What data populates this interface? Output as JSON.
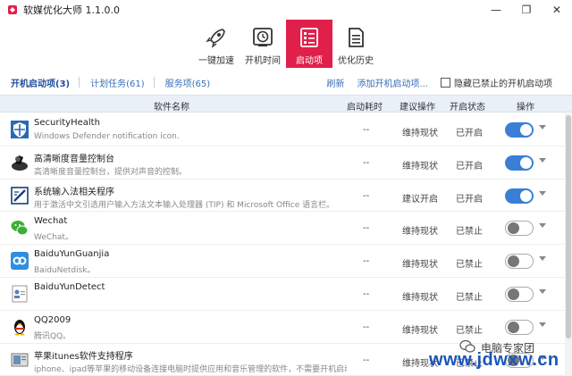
{
  "window": {
    "title": "软媒优化大师 1.1.0.0",
    "minimize": "—",
    "restore": "❐",
    "close": "✕"
  },
  "toolbar": [
    {
      "label": "一键加速",
      "icon": "rocket-icon",
      "active": false
    },
    {
      "label": "开机时间",
      "icon": "clock-icon",
      "active": false
    },
    {
      "label": "启动项",
      "icon": "startup-list-icon",
      "active": true
    },
    {
      "label": "优化历史",
      "icon": "history-document-icon",
      "active": false
    }
  ],
  "tabs": {
    "startup": "开机启动项(3)",
    "tasks": "计划任务(61)",
    "services": "服务项(65)"
  },
  "actions": {
    "refresh": "刷新",
    "add": "添加开机启动项...",
    "hide_disabled": "隐藏已禁止的开机启动项"
  },
  "columns": {
    "name": "软件名称",
    "time": "启动耗时",
    "suggest": "建议操作",
    "status": "开启状态",
    "action": "操作"
  },
  "rows": [
    {
      "name": "SecurityHealth",
      "desc": "Windows Defender notification icon.",
      "time": "--",
      "suggest": "维持现状",
      "status": "已开启",
      "enabled": true,
      "icon": "shield-icon"
    },
    {
      "name": "高清晰度音量控制台",
      "desc": "高清晰度音量控制台，提供对声音的控制。",
      "time": "--",
      "suggest": "维持现状",
      "status": "已开启",
      "enabled": true,
      "icon": "speaker-icon"
    },
    {
      "name": "系统输入法相关程序",
      "desc": "用于激活中文引选用户输入方法文本输入处理器 (TIP) 和 Microsoft Office 语言栏。",
      "time": "--",
      "suggest": "建议开启",
      "status": "已开启",
      "enabled": true,
      "icon": "input-method-icon"
    },
    {
      "name": "Wechat",
      "desc": "WeChat。",
      "time": "--",
      "suggest": "维持现状",
      "status": "已禁止",
      "enabled": false,
      "icon": "wechat-icon"
    },
    {
      "name": "BaiduYunGuanjia",
      "desc": "BaiduNetdisk。",
      "time": "--",
      "suggest": "维持现状",
      "status": "已禁止",
      "enabled": false,
      "icon": "baidu-cloud-icon"
    },
    {
      "name": "BaiduYunDetect",
      "desc": "",
      "time": "--",
      "suggest": "维持现状",
      "status": "已禁止",
      "enabled": false,
      "icon": "document-user-icon"
    },
    {
      "name": "QQ2009",
      "desc": "腾讯QQ。",
      "time": "--",
      "suggest": "维持现状",
      "status": "已禁止",
      "enabled": false,
      "icon": "qq-penguin-icon"
    },
    {
      "name": "苹果itunes软件支持程序",
      "desc": "iphone、ipad等苹果的移动设备连接电脑时提供应用和音乐管理的软件，不需要开机启动...",
      "time": "--",
      "suggest": "维持现状",
      "status": "已禁止",
      "enabled": false,
      "icon": "itunes-icon"
    }
  ],
  "watermark": {
    "brand": "电脑专家团",
    "url": "www.jdwxw.cn"
  },
  "colors": {
    "accent": "#e0204a",
    "toggle_on": "#3b7ed6",
    "link": "#3a6fb8"
  }
}
